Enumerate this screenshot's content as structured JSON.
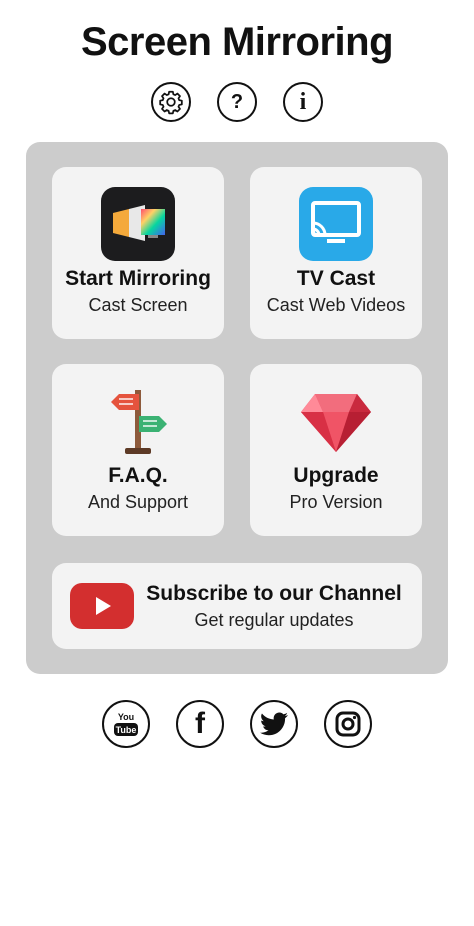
{
  "header": {
    "title": "Screen Mirroring",
    "icons": [
      "settings-gear-icon",
      "help-question-icon",
      "info-icon"
    ],
    "help_glyph": "?",
    "info_glyph": "i"
  },
  "cards": {
    "start_mirroring": {
      "title": "Start Mirroring",
      "subtitle": "Cast Screen",
      "icon": "screen-mirror-app-icon"
    },
    "tv_cast": {
      "title": "TV Cast",
      "subtitle": "Cast Web Videos",
      "icon": "tv-cast-app-icon"
    },
    "faq": {
      "title": "F.A.Q.",
      "subtitle": "And Support",
      "icon": "signpost-icon"
    },
    "upgrade": {
      "title": "Upgrade",
      "subtitle": "Pro Version",
      "icon": "ruby-gem-icon"
    },
    "subscribe": {
      "title": "Subscribe to our Channel",
      "subtitle": "Get regular updates",
      "icon": "youtube-play-icon"
    }
  },
  "social": {
    "icons": [
      "youtube-icon",
      "facebook-icon",
      "twitter-icon",
      "instagram-icon"
    ],
    "youtube_text_top": "You",
    "youtube_text_bottom": "Tube",
    "facebook_glyph": "f"
  },
  "colors": {
    "panel": "#cccccc",
    "card": "#f3f3f3",
    "youtube_red": "#d32f2f",
    "tvcast_blue": "#29a9e8",
    "ruby_red": "#e53950"
  }
}
